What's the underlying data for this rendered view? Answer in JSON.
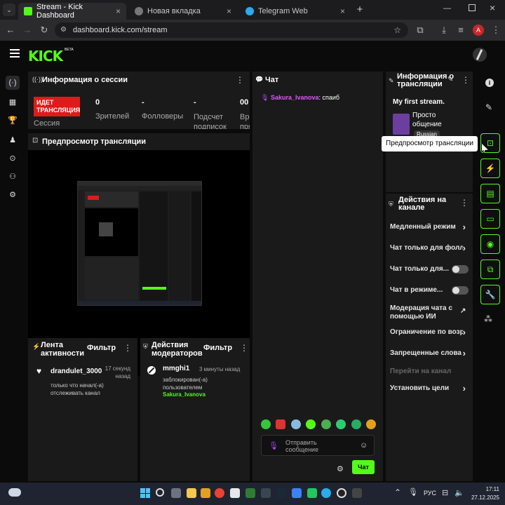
{
  "browser": {
    "tabs": [
      {
        "title": "Stream - Kick Dashboard",
        "active": true,
        "color": "#53fc18"
      },
      {
        "title": "Новая вкладка",
        "active": false,
        "color": "#777777"
      },
      {
        "title": "Telegram Web",
        "active": false,
        "color": "#2aabee"
      }
    ],
    "url": "dashboard.kick.com/stream",
    "profile_initial": "A"
  },
  "kick": {
    "logo": "KICK",
    "beta": "BETA"
  },
  "session": {
    "title": "Информация о сессии",
    "live_badge_line1": "ИДЕТ",
    "live_badge_line2": "ТРАНСЛЯЦИЯ",
    "session_label": "Сессия",
    "stats": [
      {
        "value": "0",
        "label": "Зрителей"
      },
      {
        "value": "-",
        "label": "Фолловеры"
      },
      {
        "value": "-",
        "label": "Подсчет подписок",
        "label1": "Подсчет",
        "label2": "подписок"
      },
      {
        "value": "00",
        "label": "Время прямого",
        "label1": "Вре",
        "label2": "пря"
      }
    ]
  },
  "preview": {
    "title": "Предпросмотр трансляции"
  },
  "activity": {
    "title_line1": "Лента",
    "title_line2": "активности",
    "filter": "Фильтр",
    "item_user": "drandulet_3000",
    "item_time_line1": "17 секунд",
    "item_time_line2": "назад",
    "item_text_line1": "только что начал(-а)",
    "item_text_line2": "отслеживать канал"
  },
  "mod_actions": {
    "title_line1": "Действия",
    "title_line2": "модераторов",
    "filter": "Фильтр",
    "item_user": "mmghi1",
    "item_time": "3 минуты назад",
    "item_text_line1": "заблокирован(-а)",
    "item_text_line2": "пользователем",
    "item_target": "Sakura_Ivanova"
  },
  "chat": {
    "title": "Чат",
    "message_user": "Sakura_Ivanova",
    "message_text": ": спаиб",
    "input_placeholder_line1": "Отправить",
    "input_placeholder_line2": "сообщение",
    "send_label": "Чат"
  },
  "stream_info": {
    "title_line1": "Информация о",
    "title_line2": "трансляции",
    "stream_title": "My first stream.",
    "category_line1": "Просто",
    "category_line2": "общение",
    "language": "Russian",
    "tooltip": "Предпросмотр трансляции"
  },
  "channel_actions": {
    "title_line1": "Действия на",
    "title_line2": "канале",
    "items": [
      {
        "label": "Медленный режим",
        "kind": "chevron"
      },
      {
        "label": "Чат только для фолл",
        "kind": "chevron"
      },
      {
        "label": "Чат только для...",
        "kind": "toggle"
      },
      {
        "label": "Чат в режиме...",
        "kind": "toggle"
      },
      {
        "label_line1": "Модерация чата с",
        "label_line2": "помощью ИИ",
        "kind": "external"
      },
      {
        "label": "Ограничение по возр",
        "kind": "chevron"
      },
      {
        "label": "Запрещенные слова",
        "kind": "chevron"
      },
      {
        "label": "Перейти на канал",
        "kind": "disabled"
      },
      {
        "label": "Установить цели",
        "kind": "chevron"
      }
    ]
  },
  "taskbar": {
    "lang": "РУС",
    "time": "17:11",
    "date": "27.12.2025"
  },
  "colors": {
    "accent": "#53fc18",
    "live": "#e01a1a",
    "panel": "#1a1a1b"
  }
}
